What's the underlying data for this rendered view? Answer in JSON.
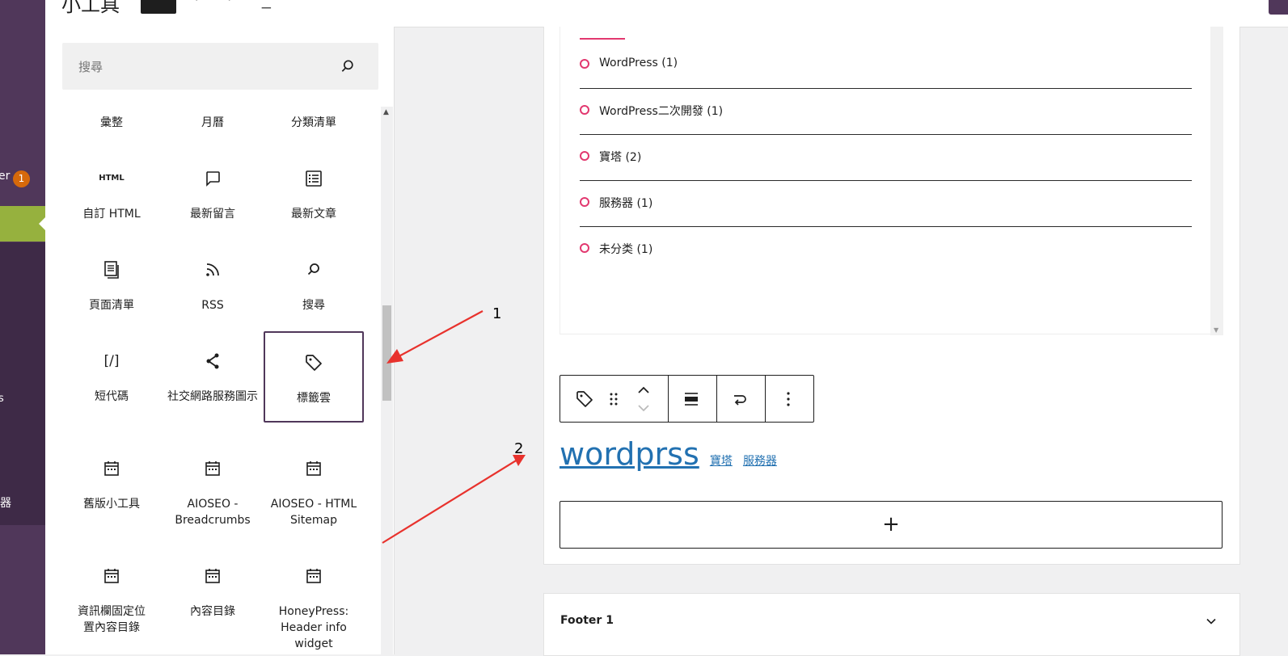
{
  "header": {
    "title": "小工具"
  },
  "admin_sidebar": {
    "partial_label_1": "er",
    "badge_count": "1",
    "partial_label_2": "s",
    "partial_label_3": "器"
  },
  "inserter": {
    "search_placeholder": "搜尋",
    "blocks": [
      {
        "label": "彙整",
        "icon": "archive-icon"
      },
      {
        "label": "月曆",
        "icon": "calendar-icon"
      },
      {
        "label": "分類清單",
        "icon": "categories-icon"
      },
      {
        "label": "自訂 HTML",
        "icon": "html-icon",
        "icon_text": "HTML"
      },
      {
        "label": "最新留言",
        "icon": "comment-icon"
      },
      {
        "label": "最新文章",
        "icon": "post-list-icon"
      },
      {
        "label": "頁面清單",
        "icon": "pages-icon"
      },
      {
        "label": "RSS",
        "icon": "rss-icon"
      },
      {
        "label": "搜尋",
        "icon": "search-icon"
      },
      {
        "label": "短代碼",
        "icon": "shortcode-icon",
        "icon_text": "[/]"
      },
      {
        "label": "社交網路服務圖示",
        "icon": "share-icon"
      },
      {
        "label": "標籤雲",
        "icon": "tag-icon",
        "selected": true
      },
      {
        "label": "舊版小工具",
        "icon": "widget-icon"
      },
      {
        "label": "AIOSEO - Breadcrumbs",
        "icon": "widget-icon"
      },
      {
        "label": "AIOSEO - HTML Sitemap",
        "icon": "widget-icon"
      },
      {
        "label": "資訊欄固定位置內容目錄",
        "icon": "widget-icon"
      },
      {
        "label": "內容目錄",
        "icon": "widget-icon"
      },
      {
        "label": "HoneyPress: Header info widget",
        "icon": "widget-icon"
      }
    ]
  },
  "categories": [
    "WordPress (1)",
    "WordPress二次開發 (1)",
    "寶塔 (2)",
    "服務器 (1)",
    "未分类 (1)"
  ],
  "tag_cloud": {
    "tags": [
      "wordprss",
      "寶塔",
      "服務器"
    ]
  },
  "appender": {
    "label": "+"
  },
  "footer_panel": {
    "label": "Footer 1"
  },
  "annotations": [
    "1",
    "2"
  ],
  "colors": {
    "admin_purple": "#50375a",
    "admin_active": "#96b13e",
    "badge_orange": "#d6690b",
    "accent_pink": "#e2386f",
    "link_blue": "#2271b1",
    "arrow_red": "#e8322d"
  }
}
